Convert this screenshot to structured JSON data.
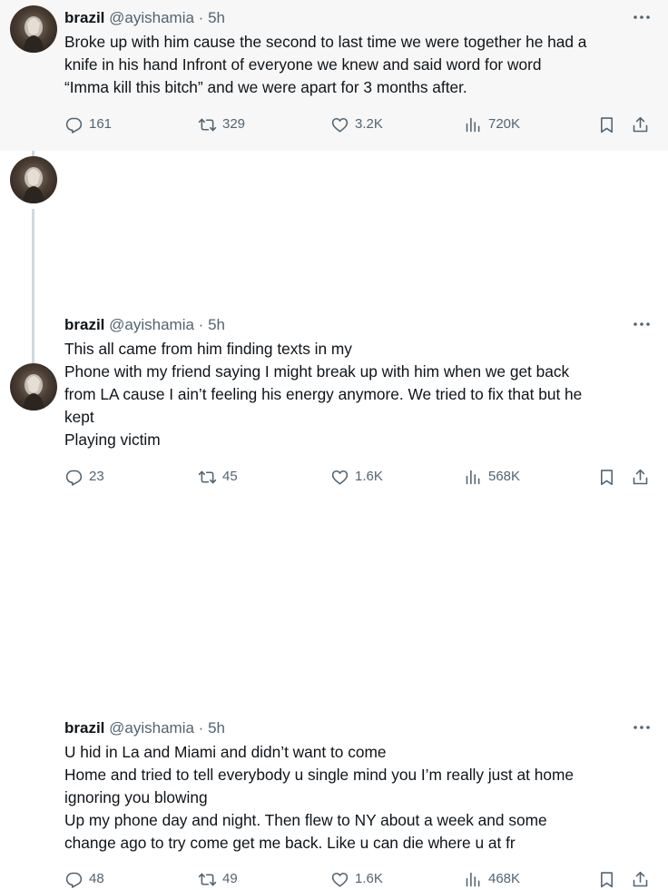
{
  "tweets": [
    {
      "name": "brazil",
      "handle": "@ayishamia",
      "dot": "·",
      "time": "5h",
      "lines": [
        "Broke up with him cause the second to last time we were together he had a",
        "knife in his hand Infront of everyone we knew and said word for word",
        "“Imma kill this bitch” and we were apart for 3 months after."
      ],
      "replies": "161",
      "retweets": "329",
      "likes": "3.2K",
      "views": "720K"
    },
    {
      "name": "brazil",
      "handle": "@ayishamia",
      "dot": "·",
      "time": "5h",
      "lines": [
        "This all came from him finding texts in my",
        "Phone with my friend saying I might break up with him when we get back",
        "from LA cause I ain’t feeling his energy anymore. We tried to fix that but he",
        "kept",
        "Playing victim"
      ],
      "replies": "23",
      "retweets": "45",
      "likes": "1.6K",
      "views": "568K"
    },
    {
      "name": "brazil",
      "handle": "@ayishamia",
      "dot": "·",
      "time": "5h",
      "lines": [
        "U hid in La and Miami and didn’t want to come",
        "Home and tried to tell everybody u single mind you I’m really just at home",
        "ignoring you blowing",
        "Up my phone day and night. Then flew to NY about a week and some",
        "change ago to try come get me back. Like u can die where u at fr"
      ],
      "replies": "48",
      "retweets": "49",
      "likes": "1.6K",
      "views": "468K"
    }
  ],
  "icons": {
    "reply": "reply-icon",
    "retweet": "retweet-icon",
    "like": "heart-icon",
    "views": "views-icon",
    "bookmark": "bookmark-icon",
    "share": "share-icon",
    "more": "more-icon"
  },
  "colors": {
    "text": "#0f1419",
    "secondary": "#536471",
    "thread_line": "#cfd9de",
    "highlight_bg": "#f7f7f7"
  }
}
